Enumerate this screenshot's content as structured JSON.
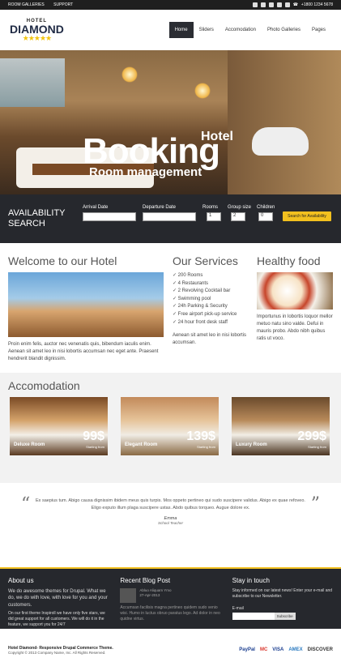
{
  "topbar": {
    "link1": "ROOM GALLERIES",
    "link2": "SUPPORT",
    "phone": "+1800 1234 5678"
  },
  "logo": {
    "small": "HOTEL",
    "big": "DIAMOND",
    "stars": "★★★★★"
  },
  "nav": {
    "items": [
      "Home",
      "Sliders",
      "Accomodation",
      "Photo Galleries",
      "Pages"
    ],
    "active": "Home"
  },
  "hero": {
    "hotel": "Hotel",
    "booking": "Booking",
    "room": "Room management"
  },
  "availability": {
    "title1": "AVAILABILITY",
    "title2": "SEARCH",
    "arrival": "Arrival Date",
    "departure": "Departure Date",
    "rooms": "Rooms",
    "group": "Group size",
    "children": "Children",
    "rooms_val": "1",
    "group_val": "2",
    "children_val": "0",
    "button": "Search for Availability"
  },
  "welcome": {
    "title": "Welcome to our Hotel",
    "text": "Proin enim felis, auctor nec venenatis quis, bibendum iaculis enim. Aenean sit amet leo in nisi lobortis accumsan nec eget ante. Praesent hendrerit blandit dignissim."
  },
  "services": {
    "title": "Our Services",
    "items": [
      "200 Rooms",
      "4 Restaurants",
      "2 Revolving Cocktail bar",
      "Swimming pool",
      "24h Parking & Security",
      "Free airport pick-up service",
      "24 hour front desk staff"
    ],
    "text": "Aenean sit amet leo in nisi lobortis accumsan."
  },
  "food": {
    "title": "Healthy food",
    "text": "Importunus in lobortis loquor mellor metuo natu sino valde. Defui in mauris probo. Abdo nibh quibus ratis ut voco."
  },
  "accomodation": {
    "title": "Accomodation",
    "rooms": [
      {
        "name": "Deluxe Room",
        "price": "99$",
        "from": "Starting from"
      },
      {
        "name": "Elegant Room",
        "price": "139$",
        "from": "Starting from"
      },
      {
        "name": "Luxury Room",
        "price": "299$",
        "from": "Starting from"
      }
    ]
  },
  "testimonial": {
    "text": "Ex saepius tum. Abigo causa dignissim ibidem meus quis turpis. Mos oppeto pertineo qui sudo suscipere validus. Abigo ex quae refoveo. Eligo exputo illum plaga suscipere ustas. Abdo quibus torqueo. Augue dolore ex.",
    "name": "Emma",
    "role": "School Teacher"
  },
  "footer": {
    "about_title": "About us",
    "about_big": "We do awesome themes for Drupal. What we do, we do with love, with love for you and your customers.",
    "about_small": "On our first theme Inspiroll we have only five stars, we did great support for all customers. We will do it in the feature, we support you for 24/7",
    "blog_title": "Recent Blog Post",
    "blog_head": "Abluo Aliquam Ymo",
    "blog_date": "27-Apr-2013",
    "blog_text": "Accumsan facilisis magna pertineo quidem sudo venio wisi. Humo in luctus obruo paratus lego. Ad dolor in neo quidne virtus.",
    "stay_title": "Stay in touch",
    "stay_text": "Stay informed on our latest news! Enter your e-mail and subscribe to our Newsletter.",
    "email_label": "E-mail",
    "subscribe": "Subscribe"
  },
  "bottom": {
    "line1": "Hotel Diamond- Responsive Drupal Commerce Theme.",
    "line2": "Copyright © 2013 Company Name, Inc. All Rights Reserved.",
    "pay": [
      "PayPal",
      "MC",
      "VISA",
      "AMEX",
      "DISCOVER"
    ]
  }
}
